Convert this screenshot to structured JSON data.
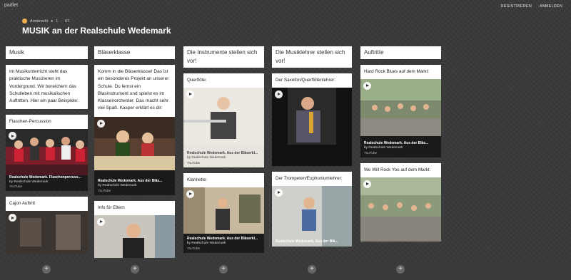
{
  "app": {
    "brand": "padlet",
    "register": "REGISTRIEREN",
    "login": "ANMELDEN"
  },
  "meta": {
    "author": "Armbrecht",
    "likes": "1",
    "sep": "·",
    "date": "6T."
  },
  "page": {
    "title": "MUSIK an der Realschule Wedemark"
  },
  "columns": [
    {
      "header": "Musik",
      "text": "Im Musikunterricht steht das praktische Musizieren im Vordergrund. Wir bereichern das Schulleben mit musikalischen Auftritten.  Hier ein paar Beispiele:",
      "cards": [
        {
          "title": "Flaschen-Percussion",
          "video_title": "Realschule Wedemark. Flaschenpercuss...",
          "by": "by Realschule Wedemark",
          "source": "YouTube"
        },
        {
          "title": "Cajon Auftritt"
        }
      ]
    },
    {
      "header": "Bläserklasse",
      "text": "Komm in die Bläserklasse! Das ist ein besonderes Projekt an unserer Schule. Du lernst ein Blasinstrument und spielst es im Klassenorchester. Das macht sehr viel Spaß. Kasper erklärt es dir:",
      "cards": [
        {
          "video_title": "Realschule Wedemark. Aus der Bläs...",
          "by": "by Realschule Wedemark",
          "source": "YouTube"
        },
        {
          "title": "Info für Eltern"
        }
      ]
    },
    {
      "header": "Die Instrumente stellen sich vor!",
      "cards": [
        {
          "title": "Querflöte:",
          "video_title": "Realschule Wedemark. Aus der Bläserkl...",
          "by": "by Realschule Wedemark",
          "source": "YouTube"
        },
        {
          "title": "Klarinette:",
          "video_title": "Realschule Wedemark. Aus der Bläserkl...",
          "by": "by Realschule Wedemark",
          "source": "YouTube"
        }
      ]
    },
    {
      "header": "Die Musiklehrer stellen sich vor!",
      "cards": [
        {
          "title": "Der Saxofon/Querflötenlehrer:"
        },
        {
          "title": "Der Trompeten/Euphoniumlehrer:",
          "video_title": "Realschule Wedemark. Aus der Blä..."
        }
      ]
    },
    {
      "header": "Auftritte",
      "cards": [
        {
          "title": "Hard Rock Blues auf dem Markt:",
          "video_title": "Realschule Wedemark. Aus der Bläs...",
          "by": "by Realschule Wedemark",
          "source": "YouTube"
        },
        {
          "title": "We Will Rock You auf dem Markt:"
        }
      ]
    }
  ],
  "add_label": "+"
}
